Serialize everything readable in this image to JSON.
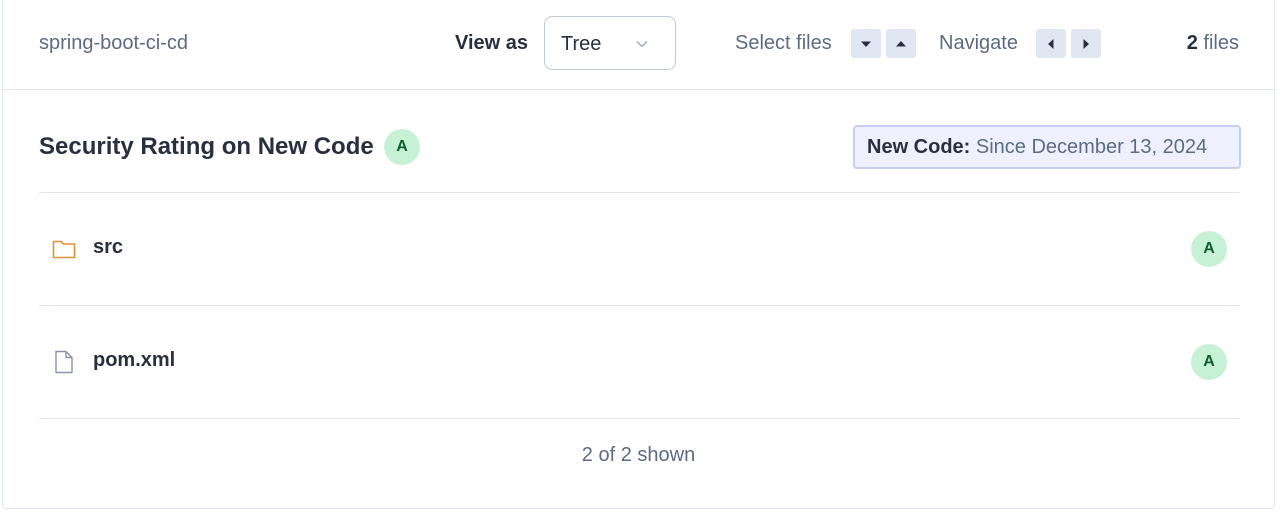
{
  "header": {
    "breadcrumb": "spring-boot-ci-cd",
    "view_as_label": "View as",
    "view_mode": "Tree",
    "select_files_label": "Select files",
    "navigate_label": "Navigate",
    "files_count": "2",
    "files_suffix": " files"
  },
  "measure": {
    "title": "Security Rating on New Code",
    "rating": "A",
    "new_code_label": "New Code:",
    "new_code_value": " Since December 13, 2024"
  },
  "rows": [
    {
      "name": "src",
      "type": "folder",
      "icon": "folder-icon",
      "rating": "A"
    },
    {
      "name": "pom.xml",
      "type": "file",
      "icon": "file-icon",
      "rating": "A"
    }
  ],
  "footer": {
    "shown": "2 of 2 shown"
  },
  "colors": {
    "rating_bg": "#c7f1d4",
    "rating_text": "#0d5f2e",
    "folder": "#e0913b",
    "newcode_bg": "#eef0fd"
  }
}
